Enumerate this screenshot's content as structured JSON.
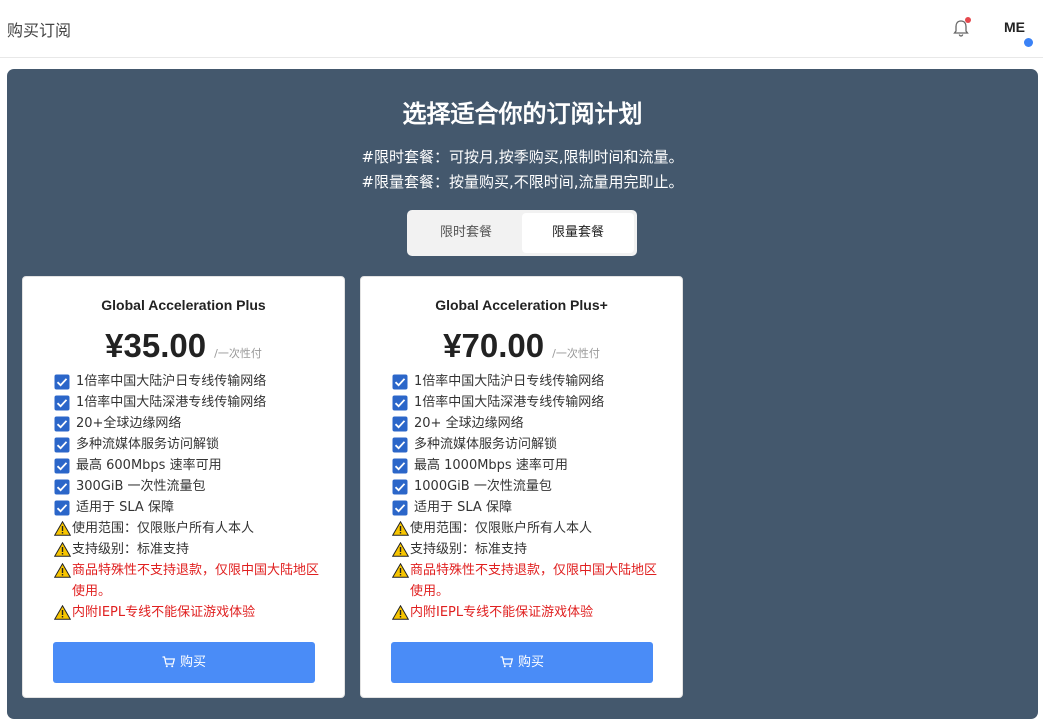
{
  "header": {
    "title": "购买订阅",
    "avatar_initials": "ME"
  },
  "hero": {
    "title": "选择适合你的订阅计划",
    "desc_line1": "#限时套餐：可按月,按季购买,限制时间和流量。",
    "desc_line2": "#限量套餐：按量购买,不限时间,流量用完即止。"
  },
  "toggle": {
    "options": [
      "限时套餐",
      "限量套餐"
    ],
    "selected": "限量套餐"
  },
  "plans": [
    {
      "name": "Global Acceleration Plus",
      "price": "¥35.00",
      "period": "/一次性付",
      "features": [
        "1倍率中国大陆沪日专线传输网络",
        "1倍率中国大陆深港专线传输网络",
        "20+全球边缘网络",
        "多种流媒体服务访问解锁",
        "最高 600Mbps 速率可用",
        "300GiB 一次性流量包",
        "适用于 SLA 保障"
      ],
      "notices": [
        "使用范围：仅限账户所有人本人",
        "支持级别：标准支持"
      ],
      "warnings": [
        "商品特殊性不支持退款，仅限中国大陆地区使用。",
        "内附IEPL专线不能保证游戏体验"
      ],
      "buy_label": "购买"
    },
    {
      "name": "Global Acceleration Plus+",
      "price": "¥70.00",
      "period": "/一次性付",
      "features": [
        "1倍率中国大陆沪日专线传输网络",
        "1倍率中国大陆深港专线传输网络",
        "20+ 全球边缘网络",
        "多种流媒体服务访问解锁",
        "最高 1000Mbps 速率可用",
        "1000GiB 一次性流量包",
        "适用于 SLA 保障"
      ],
      "notices": [
        "使用范围：仅限账户所有人本人",
        "支持级别：标准支持"
      ],
      "warnings": [
        "商品特殊性不支持退款，仅限中国大陆地区使用。",
        "内附IEPL专线不能保证游戏体验"
      ],
      "buy_label": "购买"
    }
  ],
  "colors": {
    "panel_bg": "#44586d",
    "button": "#4a8cf7",
    "check": "#2b66c9",
    "warn_red": "#e02020",
    "notify_dot": "#e5484d",
    "status_dot": "#3b82f6"
  },
  "icons": {
    "bell": "bell-icon",
    "check": "checkbox-check-icon",
    "warning": "warning-triangle-icon",
    "cart": "cart-icon"
  }
}
